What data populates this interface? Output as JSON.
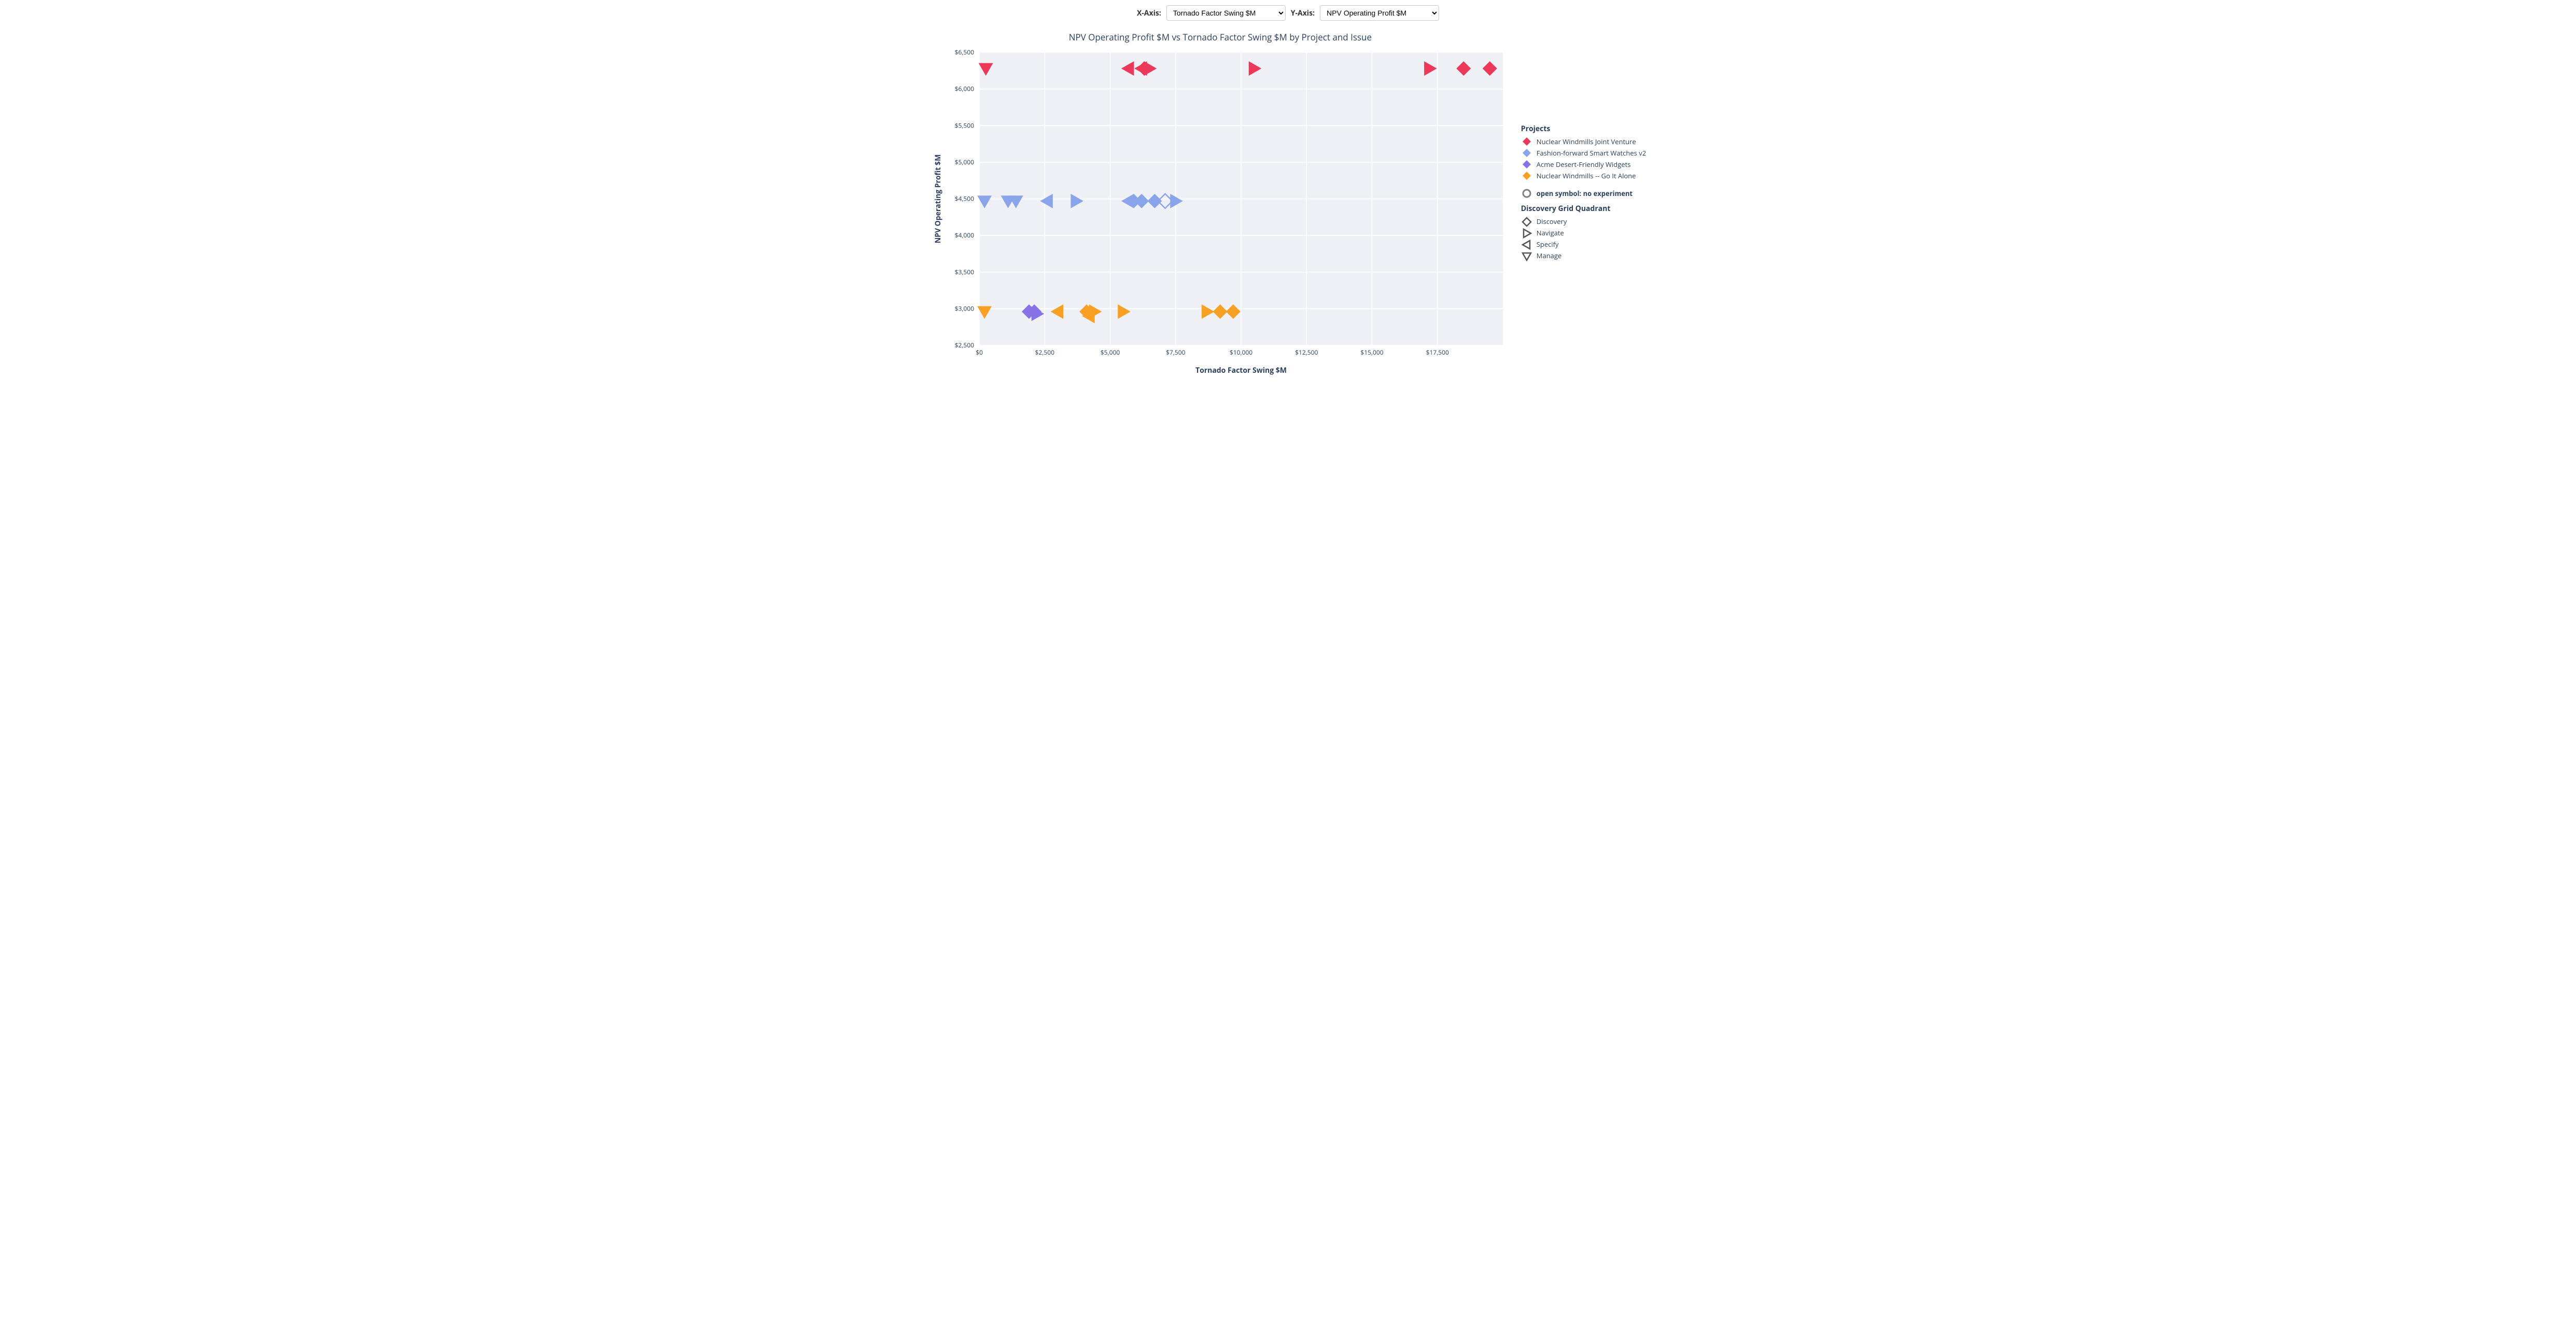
{
  "controls": {
    "x_label": "X-Axis:",
    "y_label": "Y-Axis:",
    "x_selected": "Tornado Factor Swing $M",
    "y_selected": "NPV Operating Profit $M"
  },
  "chart_data": {
    "type": "scatter",
    "title": "NPV Operating Profit $M vs Tornado Factor Swing $M by Project and Issue",
    "xlabel": "Tornado Factor Swing $M",
    "ylabel": "NPV Operating Profit $M",
    "xlim": [
      0,
      20000
    ],
    "ylim": [
      2500,
      6500
    ],
    "xticks": [
      0,
      2500,
      5000,
      7500,
      10000,
      12500,
      15000,
      17500
    ],
    "yticks": [
      2500,
      3000,
      3500,
      4000,
      4500,
      5000,
      5500,
      6000,
      6500
    ],
    "projects": [
      {
        "name": "Nuclear Windmills Joint Venture",
        "color": "#ed3959"
      },
      {
        "name": "Fashion-forward Smart Watches v2",
        "color": "#8aa4e9"
      },
      {
        "name": "Acme Desert-Friendly Widgets",
        "color": "#8772e8"
      },
      {
        "name": "Nuclear Windmills -- Go It Alone",
        "color": "#f7a023"
      }
    ],
    "quadrant_shapes": [
      {
        "name": "Discovery",
        "shape": "diamond"
      },
      {
        "name": "Navigate",
        "shape": "rtri"
      },
      {
        "name": "Specify",
        "shape": "ltri"
      },
      {
        "name": "Manage",
        "shape": "dtri"
      }
    ],
    "open_symbol_note": "open symbol: no experiment",
    "points": [
      {
        "project": "Nuclear Windmills Joint Venture",
        "x": 250,
        "y": 6280,
        "shape": "dtri",
        "open": false
      },
      {
        "project": "Nuclear Windmills Joint Venture",
        "x": 5700,
        "y": 6280,
        "shape": "ltri",
        "open": false
      },
      {
        "project": "Nuclear Windmills Joint Venture",
        "x": 6200,
        "y": 6280,
        "shape": "ltri",
        "open": false
      },
      {
        "project": "Nuclear Windmills Joint Venture",
        "x": 6300,
        "y": 6280,
        "shape": "diamond",
        "open": false
      },
      {
        "project": "Nuclear Windmills Joint Venture",
        "x": 6500,
        "y": 6280,
        "shape": "rtri",
        "open": false
      },
      {
        "project": "Nuclear Windmills Joint Venture",
        "x": 10500,
        "y": 6280,
        "shape": "rtri",
        "open": false
      },
      {
        "project": "Nuclear Windmills Joint Venture",
        "x": 17200,
        "y": 6280,
        "shape": "rtri",
        "open": false
      },
      {
        "project": "Nuclear Windmills Joint Venture",
        "x": 18500,
        "y": 6280,
        "shape": "diamond",
        "open": false
      },
      {
        "project": "Nuclear Windmills Joint Venture",
        "x": 19500,
        "y": 6280,
        "shape": "diamond",
        "open": false
      },
      {
        "project": "Fashion-forward Smart Watches v2",
        "x": 200,
        "y": 4470,
        "shape": "dtri",
        "open": false
      },
      {
        "project": "Fashion-forward Smart Watches v2",
        "x": 1100,
        "y": 4470,
        "shape": "dtri",
        "open": false
      },
      {
        "project": "Fashion-forward Smart Watches v2",
        "x": 1400,
        "y": 4470,
        "shape": "dtri",
        "open": false
      },
      {
        "project": "Fashion-forward Smart Watches v2",
        "x": 2600,
        "y": 4470,
        "shape": "ltri",
        "open": false
      },
      {
        "project": "Fashion-forward Smart Watches v2",
        "x": 3700,
        "y": 4470,
        "shape": "rtri",
        "open": false
      },
      {
        "project": "Fashion-forward Smart Watches v2",
        "x": 5700,
        "y": 4470,
        "shape": "ltri",
        "open": false
      },
      {
        "project": "Fashion-forward Smart Watches v2",
        "x": 5900,
        "y": 4470,
        "shape": "diamond",
        "open": false
      },
      {
        "project": "Fashion-forward Smart Watches v2",
        "x": 6200,
        "y": 4470,
        "shape": "diamond",
        "open": false
      },
      {
        "project": "Fashion-forward Smart Watches v2",
        "x": 6700,
        "y": 4470,
        "shape": "diamond",
        "open": false
      },
      {
        "project": "Fashion-forward Smart Watches v2",
        "x": 7100,
        "y": 4470,
        "shape": "diamond",
        "open": true
      },
      {
        "project": "Fashion-forward Smart Watches v2",
        "x": 7500,
        "y": 4470,
        "shape": "rtri",
        "open": false
      },
      {
        "project": "Acme Desert-Friendly Widgets",
        "x": 1900,
        "y": 2960,
        "shape": "diamond",
        "open": false
      },
      {
        "project": "Acme Desert-Friendly Widgets",
        "x": 2100,
        "y": 2960,
        "shape": "diamond",
        "open": false
      },
      {
        "project": "Acme Desert-Friendly Widgets",
        "x": 2200,
        "y": 2930,
        "shape": "rtri",
        "open": false
      },
      {
        "project": "Nuclear Windmills -- Go It Alone",
        "x": 200,
        "y": 2960,
        "shape": "dtri",
        "open": false
      },
      {
        "project": "Nuclear Windmills -- Go It Alone",
        "x": 3000,
        "y": 2960,
        "shape": "ltri",
        "open": false
      },
      {
        "project": "Nuclear Windmills -- Go It Alone",
        "x": 4100,
        "y": 2960,
        "shape": "diamond",
        "open": false
      },
      {
        "project": "Nuclear Windmills -- Go It Alone",
        "x": 4200,
        "y": 2900,
        "shape": "ltri",
        "open": false
      },
      {
        "project": "Nuclear Windmills -- Go It Alone",
        "x": 4400,
        "y": 2960,
        "shape": "rtri",
        "open": false
      },
      {
        "project": "Nuclear Windmills -- Go It Alone",
        "x": 5500,
        "y": 2960,
        "shape": "rtri",
        "open": false
      },
      {
        "project": "Nuclear Windmills -- Go It Alone",
        "x": 8700,
        "y": 2960,
        "shape": "rtri",
        "open": false
      },
      {
        "project": "Nuclear Windmills -- Go It Alone",
        "x": 9200,
        "y": 2960,
        "shape": "diamond",
        "open": false
      },
      {
        "project": "Nuclear Windmills -- Go It Alone",
        "x": 9700,
        "y": 2960,
        "shape": "diamond",
        "open": false
      }
    ]
  },
  "legend": {
    "projects_heading": "Projects",
    "quadrant_heading": "Discovery Grid Quadrant"
  }
}
